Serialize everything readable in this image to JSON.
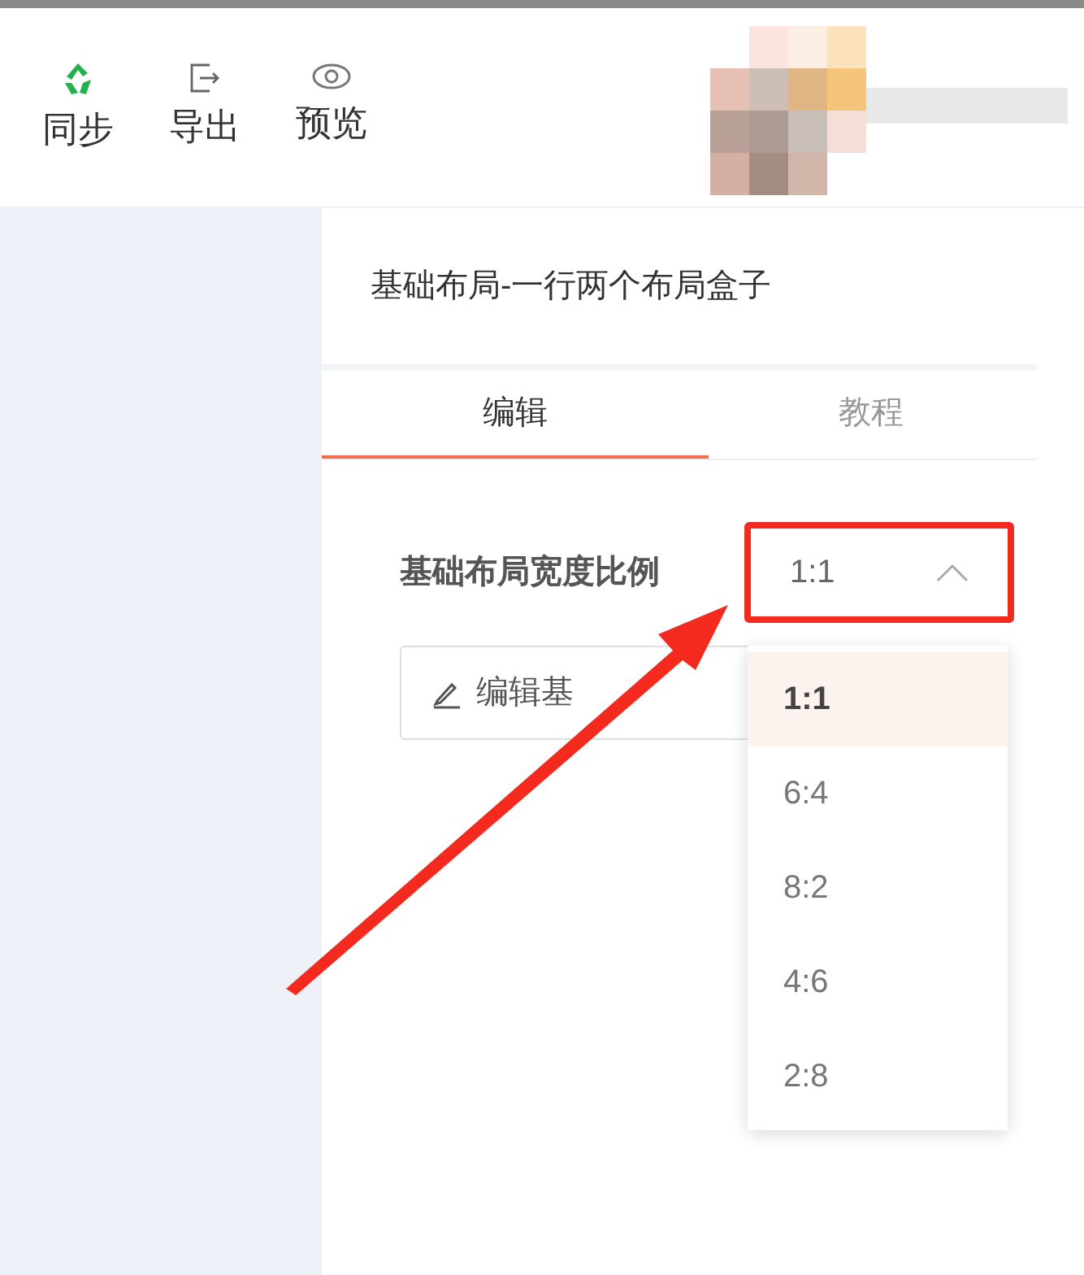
{
  "toolbar": [
    {
      "label": "同步",
      "kind": "sync"
    },
    {
      "label": "导出",
      "kind": "export"
    },
    {
      "label": "预览",
      "kind": "preview"
    }
  ],
  "panel_title": "基础布局-一行两个布局盒子",
  "tabs": [
    {
      "label": "编辑",
      "selected": true
    },
    {
      "label": "教程",
      "selected": false
    }
  ],
  "width_ratio": {
    "label": "基础布局宽度比例",
    "value": "1:1",
    "expanded": true,
    "options": [
      {
        "label": "1:1",
        "selected": true
      },
      {
        "label": "6:4",
        "selected": false
      },
      {
        "label": "8:2",
        "selected": false
      },
      {
        "label": "4:6",
        "selected": false
      },
      {
        "label": "2:8",
        "selected": false
      }
    ]
  },
  "edit_button": {
    "label": "编辑基"
  }
}
